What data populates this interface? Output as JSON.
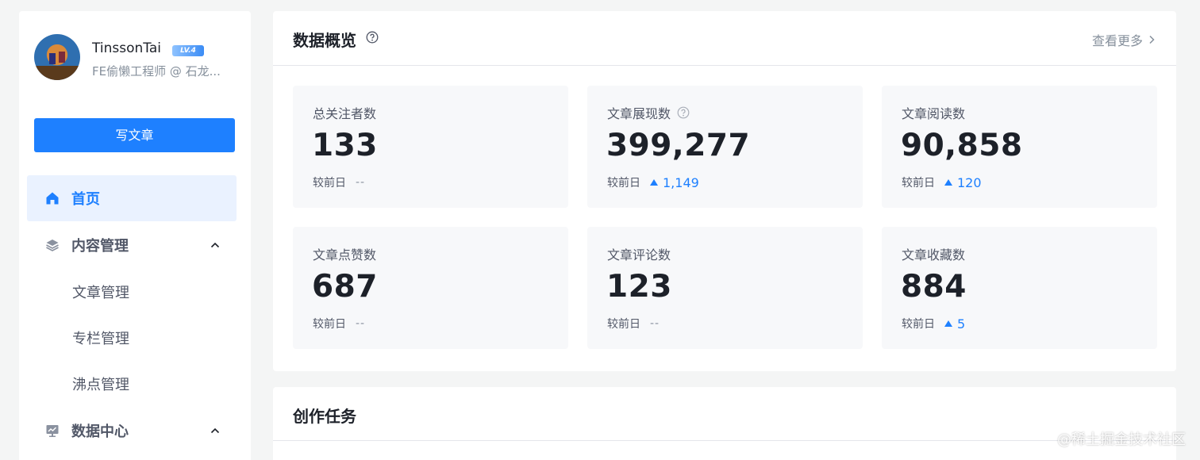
{
  "profile": {
    "username": "TinssonTai",
    "level": "LV.4",
    "subtitle": "FE偷懒工程师 @ 石龙..."
  },
  "sidebar": {
    "write_button": "写文章",
    "nav": [
      {
        "label": "首页",
        "icon": "home-icon",
        "active": true
      },
      {
        "label": "内容管理",
        "icon": "layers-icon",
        "expanded": true
      },
      {
        "label": "数据中心",
        "icon": "monitor-chart-icon",
        "expanded": true
      }
    ],
    "content_sub": [
      "文章管理",
      "专栏管理",
      "沸点管理"
    ]
  },
  "overview": {
    "title": "数据概览",
    "more_label": "查看更多",
    "delta_prefix": "较前日",
    "stats": [
      {
        "label": "总关注者数",
        "value": "133",
        "delta": "--",
        "trend": "none",
        "help": false
      },
      {
        "label": "文章展现数",
        "value": "399,277",
        "delta": "1,149",
        "trend": "up",
        "help": true
      },
      {
        "label": "文章阅读数",
        "value": "90,858",
        "delta": "120",
        "trend": "up",
        "help": false
      },
      {
        "label": "文章点赞数",
        "value": "687",
        "delta": "--",
        "trend": "none",
        "help": false
      },
      {
        "label": "文章评论数",
        "value": "123",
        "delta": "--",
        "trend": "none",
        "help": false
      },
      {
        "label": "文章收藏数",
        "value": "884",
        "delta": "5",
        "trend": "up",
        "help": false
      }
    ]
  },
  "tasks": {
    "title": "创作任务"
  },
  "watermark": "@稀土掘金技术社区",
  "colors": {
    "accent": "#1e80ff",
    "page_bg": "#f4f5f5",
    "card_bg": "#f7f8fa",
    "active_nav_bg": "#eaf2ff"
  }
}
